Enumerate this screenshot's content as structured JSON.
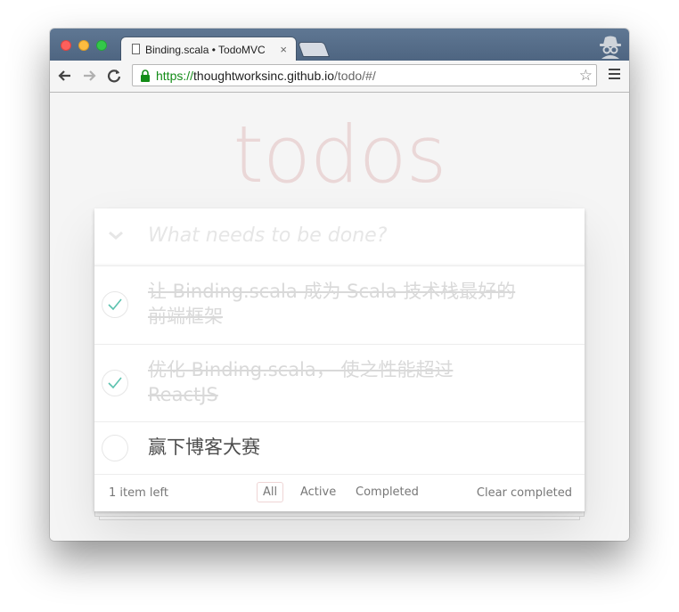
{
  "browser": {
    "tab_title": "Binding.scala • TodoMVC",
    "tab_close": "×",
    "url_scheme": "https://",
    "url_host": "thoughtworksinc.github.io",
    "url_path": "/todo/#/",
    "icons": [
      "back-arrow-icon",
      "forward-arrow-icon",
      "reload-icon",
      "lock-icon",
      "star-icon",
      "menu-icon",
      "incognito-icon",
      "page-icon",
      "close-icon"
    ],
    "colors": {
      "titlebar": "#56708e",
      "secure_green": "#138c17"
    }
  },
  "app": {
    "title": "todos",
    "new_todo_placeholder": "What needs to be done?",
    "todos": [
      {
        "text": "让 Binding.scala 成为 Scala 技术栈最好的前端框架",
        "completed": true
      },
      {
        "text": "优化 Binding.scala， 使之性能超过 ReactJS",
        "completed": true
      },
      {
        "text": "赢下博客大赛",
        "completed": false
      }
    ],
    "footer": {
      "count": "1 item left",
      "filters": [
        "All",
        "Active",
        "Completed"
      ],
      "selected_filter": "All",
      "clear": "Clear completed"
    },
    "colors": {
      "check_green": "#5dc2af",
      "title": "#e9d6d6"
    }
  }
}
